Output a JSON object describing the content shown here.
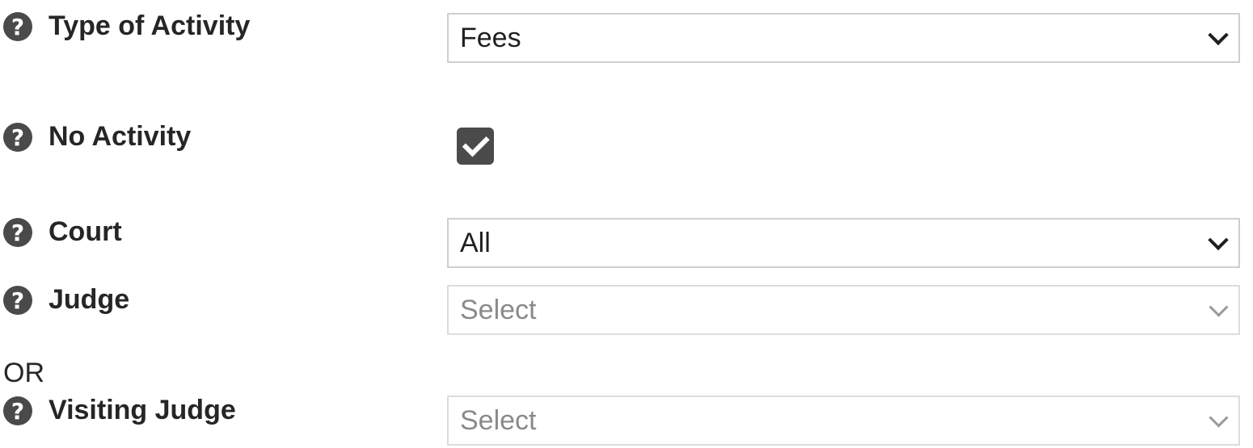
{
  "fields": {
    "type_of_activity": {
      "label": "Type of Activity",
      "value": "Fees"
    },
    "no_activity": {
      "label": "No Activity",
      "checked": true
    },
    "court": {
      "label": "Court",
      "value": "All"
    },
    "judge": {
      "label": "Judge",
      "placeholder": "Select",
      "disabled": true
    },
    "or_text": "OR",
    "visiting_judge": {
      "label": "Visiting Judge",
      "placeholder": "Select",
      "disabled": true
    }
  },
  "icons": {
    "help": "question-circle-icon",
    "dropdown": "chevron-down-icon",
    "checkbox": "checkmark-icon"
  },
  "colors": {
    "icon_bg": "#4a4a4a",
    "checkbox_bg": "#4b4b4b",
    "border": "#cfcfcf",
    "disabled_text": "#8a8a8a"
  }
}
